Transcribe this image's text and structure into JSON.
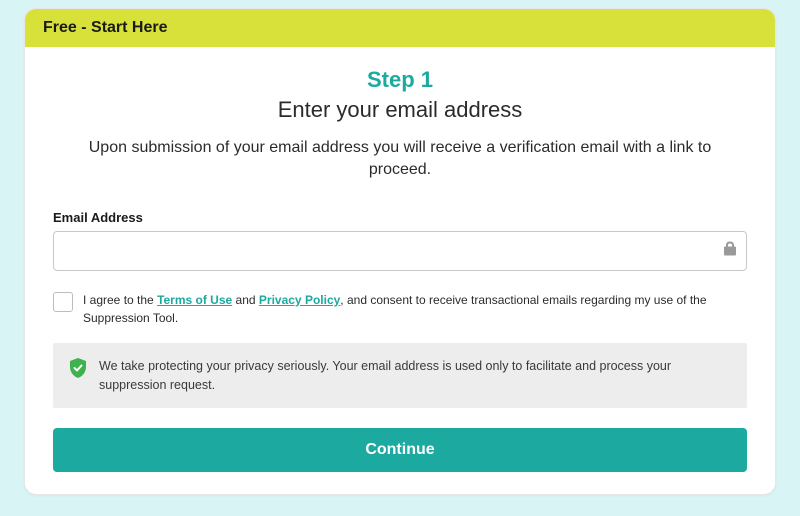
{
  "header": {
    "title": "Free - Start Here"
  },
  "step": {
    "label": "Step 1",
    "subtitle": "Enter your email address",
    "description": "Upon submission of your email address you will receive a verification email with a link to proceed."
  },
  "form": {
    "email_label": "Email Address",
    "email_value": "",
    "email_placeholder": ""
  },
  "consent": {
    "prefix": "I agree to the ",
    "terms_label": "Terms of Use",
    "middle": " and ",
    "privacy_label": "Privacy Policy",
    "suffix": ", and consent to receive transactional emails regarding my use of the Suppression Tool."
  },
  "privacy_notice": "We take protecting your privacy seriously. Your email address is used only to facilitate and process your suppression request.",
  "actions": {
    "continue_label": "Continue"
  },
  "colors": {
    "accent": "#1ba9a0",
    "header_bg": "#d8e13a",
    "shield": "#3fb24f"
  }
}
